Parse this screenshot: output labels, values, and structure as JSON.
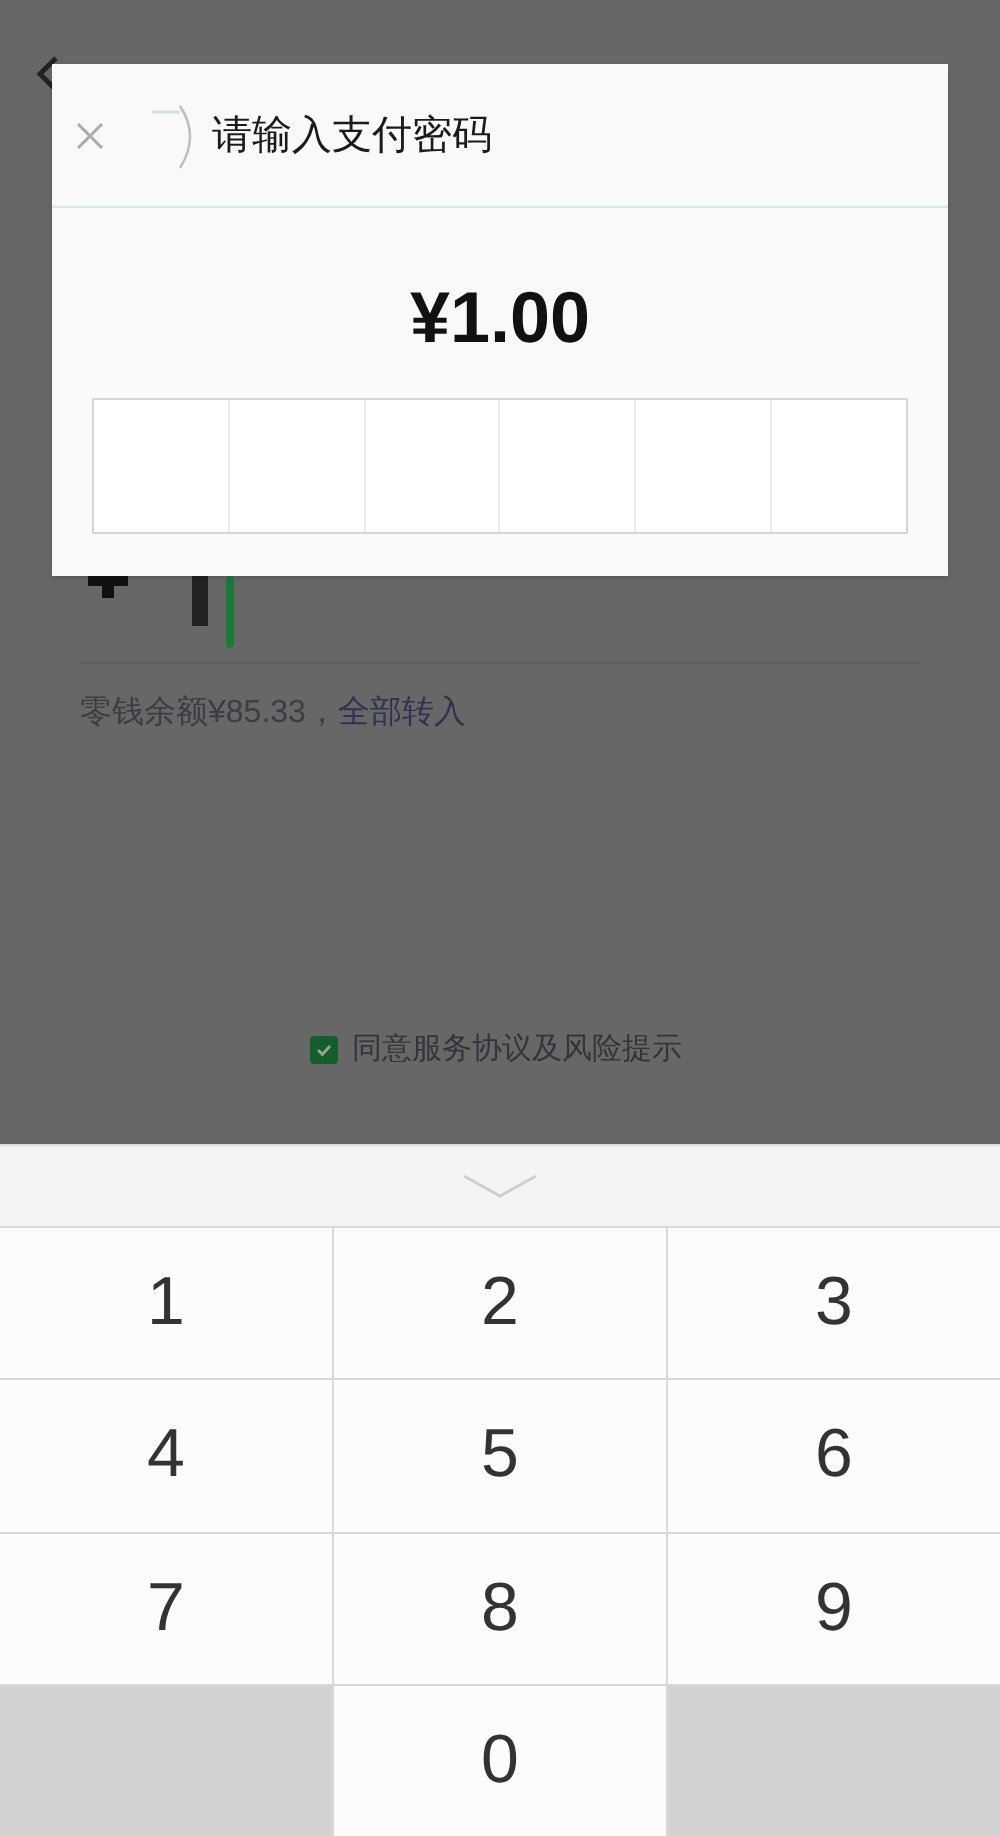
{
  "page": {
    "balance_text": "零钱余额¥85.33，",
    "balance_link": "全部转入",
    "agreement": {
      "label": "同意服务协议及风险提示",
      "checked": true
    }
  },
  "dialog": {
    "title": "请输入支付密码",
    "amount": "¥1.00",
    "password_cells": [
      {
        "filled": false
      },
      {
        "filled": false
      },
      {
        "filled": false
      },
      {
        "filled": false
      },
      {
        "filled": false
      },
      {
        "filled": false
      }
    ]
  },
  "keypad": {
    "keys": [
      {
        "kind": "digit",
        "label": "1"
      },
      {
        "kind": "digit",
        "label": "2"
      },
      {
        "kind": "digit",
        "label": "3"
      },
      {
        "kind": "digit",
        "label": "4"
      },
      {
        "kind": "digit",
        "label": "5"
      },
      {
        "kind": "digit",
        "label": "6"
      },
      {
        "kind": "digit",
        "label": "7"
      },
      {
        "kind": "digit",
        "label": "8"
      },
      {
        "kind": "digit",
        "label": "9"
      },
      {
        "kind": "blank"
      },
      {
        "kind": "digit",
        "label": "0"
      },
      {
        "kind": "blank"
      }
    ]
  }
}
